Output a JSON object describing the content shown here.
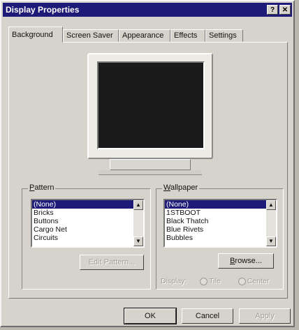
{
  "window": {
    "title": "Display Properties",
    "help_label": "?",
    "close_label": "✕"
  },
  "tabs": [
    {
      "label": "Background"
    },
    {
      "label": "Screen Saver"
    },
    {
      "label": "Appearance"
    },
    {
      "label": "Effects"
    },
    {
      "label": "Settings"
    }
  ],
  "pattern": {
    "label_first": "P",
    "label_rest": "attern",
    "items": [
      "(None)",
      "Bricks",
      "Buttons",
      "Cargo Net",
      "Circuits"
    ],
    "selected": "(None)",
    "edit_button": "Edit Pattern..."
  },
  "wallpaper": {
    "label_first": "W",
    "label_rest": "allpaper",
    "items": [
      "(None)",
      "1STBOOT",
      "Black Thatch",
      "Blue Rivets",
      "Bubbles"
    ],
    "selected": "(None)",
    "browse_first": "B",
    "browse_rest": "rowse...",
    "display_label": "Display:",
    "tile_label": "Tile",
    "center_label": "Center"
  },
  "footer": {
    "ok": "OK",
    "cancel": "Cancel",
    "apply": "Apply"
  },
  "colors": {
    "titlebar": "#1d1a78",
    "preview_screen": "#1a1a1a",
    "selection": "#1d1a78"
  },
  "icons": [
    "help-icon",
    "close-icon",
    "scroll-up-arrow-icon",
    "scroll-down-arrow-icon"
  ]
}
